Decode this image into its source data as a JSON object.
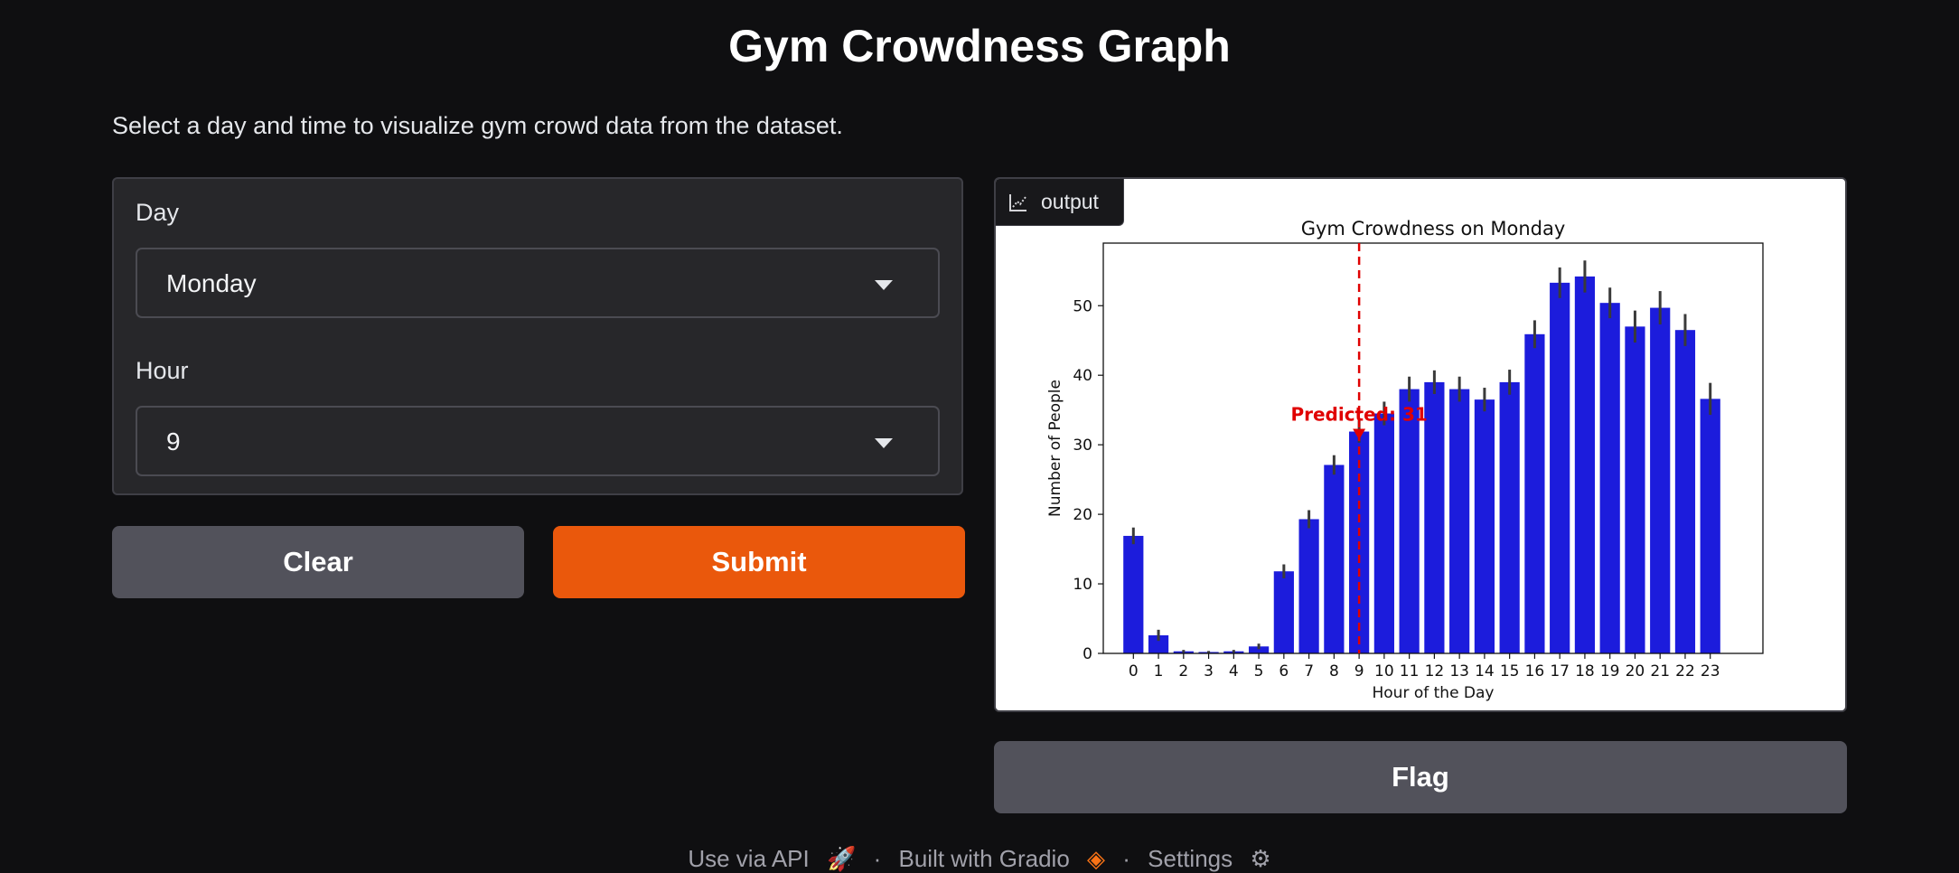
{
  "page": {
    "title": "Gym Crowdness Graph",
    "description": "Select a day and time to visualize gym crowd data from the dataset."
  },
  "form": {
    "day_label": "Day",
    "day_value": "Monday",
    "hour_label": "Hour",
    "hour_value": "9"
  },
  "buttons": {
    "clear": "Clear",
    "submit": "Submit",
    "flag": "Flag"
  },
  "output": {
    "label": "output",
    "icon": "chart-icon"
  },
  "footer": {
    "api": "Use via API",
    "built": "Built with Gradio",
    "settings": "Settings",
    "separator": "·"
  },
  "colors": {
    "accent": "#ea580c",
    "bar": "#1c1cdc",
    "prediction": "#e00000"
  },
  "chart_data": {
    "type": "bar",
    "title": "Gym Crowdness on Monday",
    "xlabel": "Hour of the Day",
    "ylabel": "Number of People",
    "categories": [
      "0",
      "1",
      "2",
      "3",
      "4",
      "5",
      "6",
      "7",
      "8",
      "9",
      "10",
      "11",
      "12",
      "13",
      "14",
      "15",
      "16",
      "17",
      "18",
      "19",
      "20",
      "21",
      "22",
      "23"
    ],
    "values": [
      16.9,
      2.6,
      0.3,
      0.2,
      0.3,
      1.0,
      11.8,
      19.3,
      27.1,
      31.9,
      34.5,
      38.0,
      39.0,
      38.0,
      36.5,
      39.0,
      45.9,
      53.3,
      54.2,
      50.4,
      47.0,
      49.7,
      46.5,
      36.6
    ],
    "errors": [
      1.2,
      0.8,
      0.2,
      0.15,
      0.2,
      0.4,
      1.0,
      1.3,
      1.4,
      1.6,
      1.7,
      1.8,
      1.7,
      1.8,
      1.7,
      1.8,
      2.0,
      2.2,
      2.3,
      2.2,
      2.3,
      2.4,
      2.3,
      2.3
    ],
    "ylim": [
      0,
      59
    ],
    "yticks": [
      0,
      10,
      20,
      30,
      40,
      50
    ],
    "highlight_hour": 9,
    "annotation": "Predicted: 31",
    "annotation_value": 31
  }
}
